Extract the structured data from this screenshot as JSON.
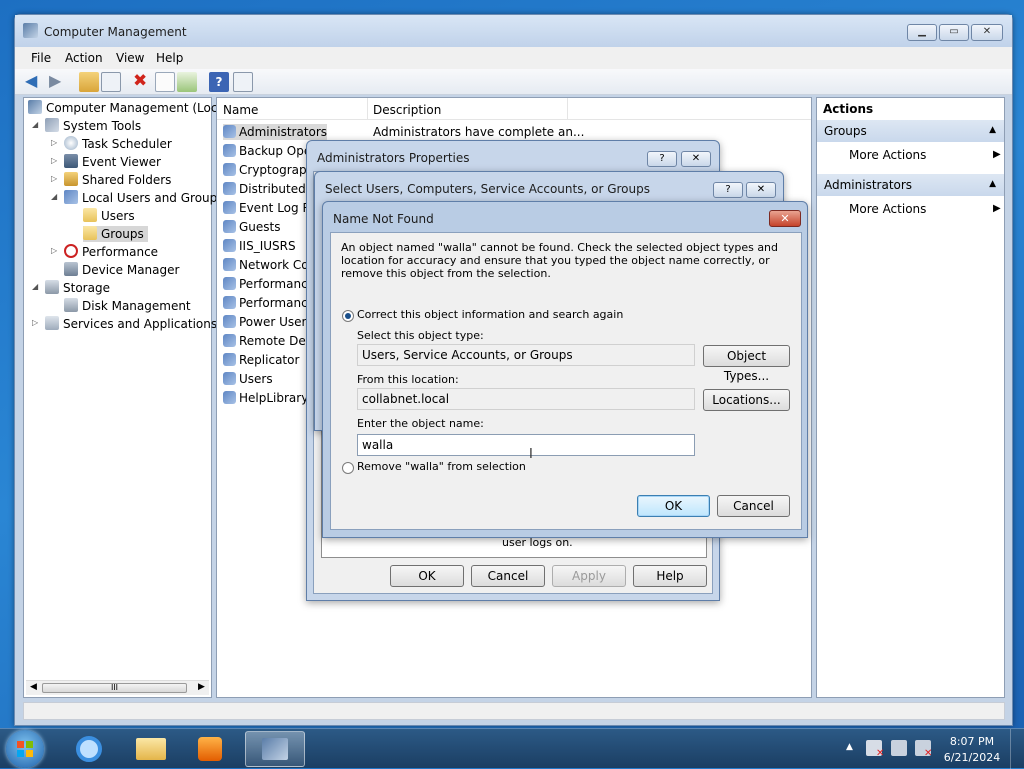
{
  "window": {
    "title": "Computer Management",
    "menu": [
      "File",
      "Action",
      "View",
      "Help"
    ]
  },
  "tree": {
    "root": "Computer Management (Local",
    "system_tools": "System Tools",
    "task_scheduler": "Task Scheduler",
    "event_viewer": "Event Viewer",
    "shared_folders": "Shared Folders",
    "local_users_groups": "Local Users and Groups",
    "users": "Users",
    "groups": "Groups",
    "performance": "Performance",
    "device_manager": "Device Manager",
    "storage": "Storage",
    "disk_management": "Disk Management",
    "services_apps": "Services and Applications",
    "scroll_grip": "III"
  },
  "list": {
    "col_name": "Name",
    "col_desc": "Description",
    "rows": [
      {
        "name": "Administrators",
        "desc": "Administrators have complete an..."
      },
      {
        "name": "Backup Oper",
        "desc": ""
      },
      {
        "name": "Cryptograph",
        "desc": ""
      },
      {
        "name": "Distributed C",
        "desc": ""
      },
      {
        "name": "Event Log Re",
        "desc": ""
      },
      {
        "name": "Guests",
        "desc": ""
      },
      {
        "name": "IIS_IUSRS",
        "desc": ""
      },
      {
        "name": "Network Cor",
        "desc": ""
      },
      {
        "name": "Performance",
        "desc": ""
      },
      {
        "name": "Performance",
        "desc": ""
      },
      {
        "name": "Power Users",
        "desc": ""
      },
      {
        "name": "Remote Desk",
        "desc": ""
      },
      {
        "name": "Replicator",
        "desc": ""
      },
      {
        "name": "Users",
        "desc": ""
      },
      {
        "name": "HelpLibraryU",
        "desc": ""
      }
    ]
  },
  "actions": {
    "header": "Actions",
    "section1": "Groups",
    "section1_item": "More Actions",
    "section2": "Administrators",
    "section2_item": "More Actions"
  },
  "admin_props": {
    "title": "Administrators Properties",
    "partial_text": "user logs on.",
    "ok": "OK",
    "cancel": "Cancel",
    "apply": "Apply",
    "help": "Help"
  },
  "select_users": {
    "title": "Select Users, Computers, Service Accounts, or Groups"
  },
  "not_found": {
    "title": "Name Not Found",
    "message": "An object named \"walla\" cannot be found. Check the selected object types and location for accuracy and ensure that you typed the object name correctly, or remove this object from the selection.",
    "radio_correct": "Correct this object information and search again",
    "label_type": "Select this object type:",
    "value_type": "Users, Service Accounts, or Groups",
    "btn_types": "Object Types...",
    "label_location": "From this location:",
    "value_location": "collabnet.local",
    "btn_locations": "Locations...",
    "label_name": "Enter the object name:",
    "value_name": "walla",
    "radio_remove": "Remove \"walla\" from selection",
    "ok": "OK",
    "cancel": "Cancel"
  },
  "taskbar": {
    "time": "8:07 PM",
    "date": "6/21/2024"
  },
  "help_glyph": "?"
}
